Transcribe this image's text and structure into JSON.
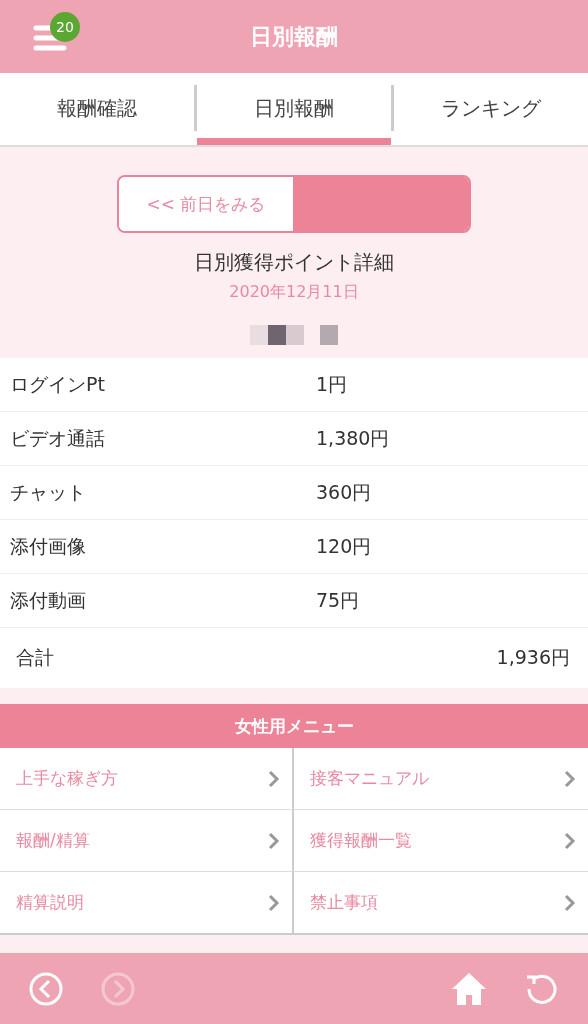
{
  "header": {
    "title": "日別報酬",
    "badge": "20"
  },
  "tabs": [
    {
      "label": "報酬確認",
      "selected": false
    },
    {
      "label": "日別報酬",
      "selected": true
    },
    {
      "label": "ランキング",
      "selected": false
    }
  ],
  "date_nav": {
    "prev_button": "<< 前日をみる"
  },
  "detail": {
    "title": "日別獲得ポイント詳細",
    "date": "2020年12月11日"
  },
  "rows": [
    {
      "label": "ログインPt",
      "value": "1円"
    },
    {
      "label": "ビデオ通話",
      "value": "1,380円"
    },
    {
      "label": "チャット",
      "value": "360円"
    },
    {
      "label": "添付画像",
      "value": "120円"
    },
    {
      "label": "添付動画",
      "value": "75円"
    }
  ],
  "total": {
    "label": "合計",
    "value": "1,936円"
  },
  "menu": {
    "title": "女性用メニュー",
    "items": [
      "上手な稼ぎ方",
      "接客マニュアル",
      "報酬/精算",
      "獲得報酬一覧",
      "精算説明",
      "禁止事項"
    ]
  },
  "footer": {
    "back_disabled": false,
    "forward_disabled": true
  }
}
